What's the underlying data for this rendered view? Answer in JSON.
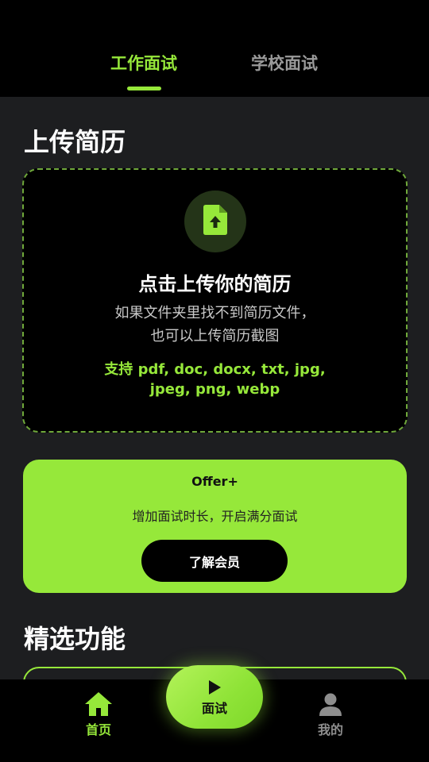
{
  "tabs": [
    {
      "label": "工作面试",
      "active": true
    },
    {
      "label": "学校面试",
      "active": false
    }
  ],
  "upload": {
    "section_title": "上传简历",
    "icon": "file-upload-icon",
    "title": "点击上传你的简历",
    "desc_line1": "如果文件夹里找不到简历文件，",
    "desc_line2": "也可以上传简历截图",
    "support_line1": "支持 pdf, doc, docx, txt, jpg,",
    "support_line2": "jpeg, png, webp"
  },
  "offer": {
    "title": "Offer+",
    "desc": "增加面试时长，开启满分面试",
    "button_label": "了解会员"
  },
  "featured": {
    "section_title": "精选功能"
  },
  "bottom_nav": {
    "home_label": "首页",
    "home_icon": "home-icon",
    "center_label": "面试",
    "center_icon": "play-icon",
    "me_label": "我的",
    "me_icon": "user-icon"
  },
  "colors": {
    "accent": "#96e83a",
    "background": "#1d1e20",
    "card": "#000000"
  }
}
